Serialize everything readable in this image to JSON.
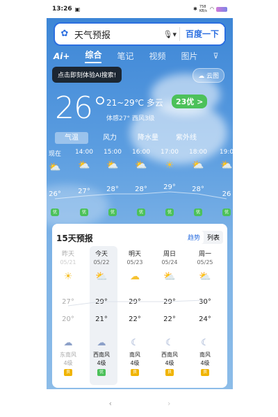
{
  "status": {
    "time": "13:26",
    "speed": "758 KB/s"
  },
  "search": {
    "query": "天气预报",
    "button": "百度一下"
  },
  "tabs": [
    {
      "label": "综合"
    },
    {
      "label": "笔记"
    },
    {
      "label": "视频"
    },
    {
      "label": "图片"
    }
  ],
  "ai_label": "Ai+",
  "tooltip": "点击即刻体验AI搜索!",
  "cloud_map": "云图",
  "current": {
    "temp": "26°",
    "range": "21~29℃  多云",
    "aqi": "23优 >",
    "feel": "体感27°   西风3级"
  },
  "chips": [
    "气温",
    "风力",
    "降水量",
    "紫外线"
  ],
  "hourly": [
    {
      "time": "现在",
      "temp": "26°",
      "aqi": "优"
    },
    {
      "time": "14:00",
      "temp": "27°",
      "aqi": "优"
    },
    {
      "time": "15:00",
      "temp": "28°",
      "aqi": "优"
    },
    {
      "time": "16:00",
      "temp": "28°",
      "aqi": "优"
    },
    {
      "time": "17:00",
      "temp": "29°",
      "aqi": "优"
    },
    {
      "time": "18:00",
      "temp": "28°",
      "aqi": "优"
    },
    {
      "time": "19:0",
      "temp": "26",
      "aqi": "优"
    }
  ],
  "forecast": {
    "title": "15天预报",
    "toggle": [
      "趋势",
      "列表"
    ],
    "days": [
      {
        "day": "昨天",
        "date": "05/21",
        "high": "27°",
        "low": "20°",
        "wind1": "东南风",
        "wind2": "4级",
        "aqi": "良"
      },
      {
        "day": "今天",
        "date": "05/22",
        "high": "29°",
        "low": "21°",
        "wind1": "西南风",
        "wind2": "4级",
        "aqi": "优"
      },
      {
        "day": "明天",
        "date": "05/23",
        "high": "29°",
        "low": "22°",
        "wind1": "南风",
        "wind2": "4级",
        "aqi": "良"
      },
      {
        "day": "周日",
        "date": "05/24",
        "high": "29°",
        "low": "22°",
        "wind1": "西南风",
        "wind2": "4级",
        "aqi": "良"
      },
      {
        "day": "周一",
        "date": "05/25",
        "high": "30°",
        "low": "24°",
        "wind1": "南风",
        "wind2": "4级",
        "aqi": "良"
      }
    ]
  },
  "nav": {
    "back": "‹",
    "forward": "›"
  }
}
